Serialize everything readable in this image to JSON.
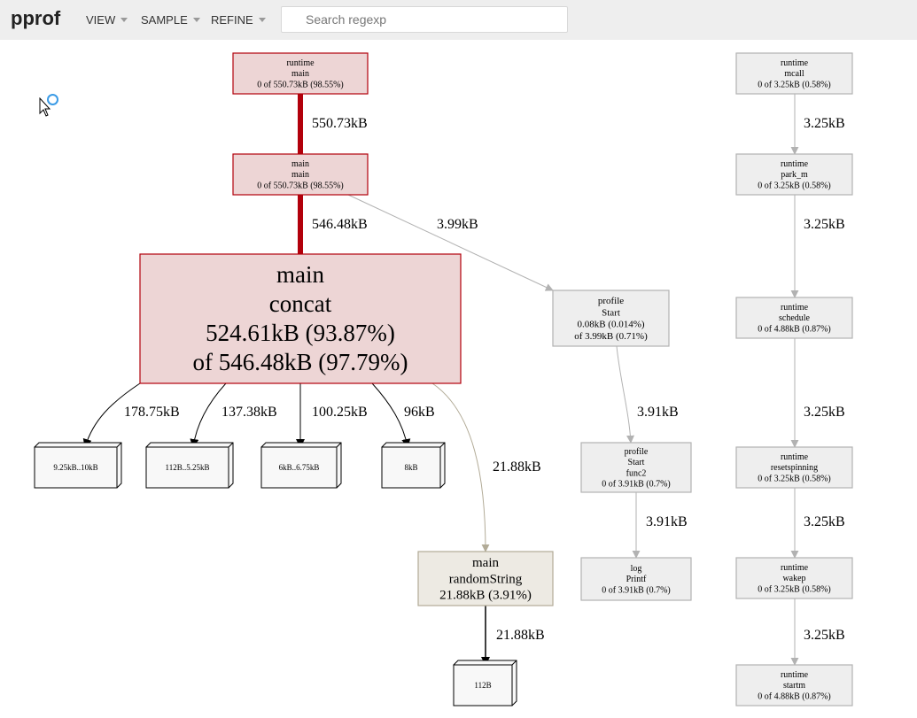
{
  "header": {
    "brand": "pprof",
    "menu": [
      "VIEW",
      "SAMPLE",
      "REFINE"
    ],
    "search_placeholder": "Search regexp"
  },
  "colors": {
    "hot_fill": "#edd5d5",
    "hot_stroke": "#b2000b",
    "warm_fill": "#edeae3",
    "warm_stroke": "#b2ab97",
    "cold_fill": "#eeeeee",
    "cold_stroke": "#b2b2b2",
    "hot_edge": "#b2000b",
    "grey_edge": "#b2b2b2"
  },
  "nodes": [
    {
      "id": "runtime_main",
      "lines": [
        "runtime",
        "main",
        "0 of 550.73kB (98.55%)"
      ],
      "style": "hot"
    },
    {
      "id": "main_main",
      "lines": [
        "main",
        "main",
        "0 of 550.73kB (98.55%)"
      ],
      "style": "hot"
    },
    {
      "id": "main_concat",
      "lines": [
        "main",
        "concat",
        "524.61kB (93.87%)",
        "of 546.48kB (97.79%)"
      ],
      "style": "hot"
    },
    {
      "id": "profile_start",
      "lines": [
        "profile",
        "Start",
        "0.08kB (0.014%)",
        "of 3.99kB (0.71%)"
      ],
      "style": "cold"
    },
    {
      "id": "profile_start_func2",
      "lines": [
        "profile",
        "Start",
        "func2",
        "0 of 3.91kB (0.7%)"
      ],
      "style": "cold"
    },
    {
      "id": "log_printf",
      "lines": [
        "log",
        "Printf",
        "0 of 3.91kB (0.7%)"
      ],
      "style": "cold"
    },
    {
      "id": "main_randomString",
      "lines": [
        "main",
        "randomString",
        "21.88kB (3.91%)"
      ],
      "style": "warm"
    },
    {
      "id": "runtime_mcall",
      "lines": [
        "runtime",
        "mcall",
        "0 of 3.25kB (0.58%)"
      ],
      "style": "cold"
    },
    {
      "id": "runtime_park_m",
      "lines": [
        "runtime",
        "park_m",
        "0 of 3.25kB (0.58%)"
      ],
      "style": "cold"
    },
    {
      "id": "runtime_schedule",
      "lines": [
        "runtime",
        "schedule",
        "0 of 4.88kB (0.87%)"
      ],
      "style": "cold"
    },
    {
      "id": "runtime_resetspinning",
      "lines": [
        "runtime",
        "resetspinning",
        "0 of 3.25kB (0.58%)"
      ],
      "style": "cold"
    },
    {
      "id": "runtime_wakep",
      "lines": [
        "runtime",
        "wakep",
        "0 of 3.25kB (0.58%)"
      ],
      "style": "cold"
    },
    {
      "id": "runtime_startm",
      "lines": [
        "runtime",
        "startm",
        "0 of 4.88kB (0.87%)"
      ],
      "style": "cold"
    }
  ],
  "size_boxes": [
    {
      "id": "b1",
      "label": "9.25kB..10kB"
    },
    {
      "id": "b2",
      "label": "112B..5.25kB"
    },
    {
      "id": "b3",
      "label": "6kB..6.75kB"
    },
    {
      "id": "b4",
      "label": "8kB"
    },
    {
      "id": "b5",
      "label": "112B"
    }
  ],
  "edges": [
    {
      "from": "runtime_main",
      "to": "main_main",
      "label": "550.73kB",
      "style": "hot"
    },
    {
      "from": "main_main",
      "to": "main_concat",
      "label": "546.48kB",
      "style": "hot"
    },
    {
      "from": "main_main",
      "to": "profile_start",
      "label": "3.99kB",
      "style": "grey"
    },
    {
      "from": "main_concat",
      "to": "b1",
      "label": "178.75kB",
      "style": "black"
    },
    {
      "from": "main_concat",
      "to": "b2",
      "label": "137.38kB",
      "style": "black"
    },
    {
      "from": "main_concat",
      "to": "b3",
      "label": "100.25kB",
      "style": "black"
    },
    {
      "from": "main_concat",
      "to": "b4",
      "label": "96kB",
      "style": "black"
    },
    {
      "from": "main_concat",
      "to": "main_randomString",
      "label": "21.88kB",
      "style": "warm"
    },
    {
      "from": "main_randomString",
      "to": "b5",
      "label": "21.88kB",
      "style": "black"
    },
    {
      "from": "profile_start",
      "to": "profile_start_func2",
      "label": "3.91kB",
      "style": "grey"
    },
    {
      "from": "profile_start_func2",
      "to": "log_printf",
      "label": "3.91kB",
      "style": "grey"
    },
    {
      "from": "runtime_mcall",
      "to": "runtime_park_m",
      "label": "3.25kB",
      "style": "grey"
    },
    {
      "from": "runtime_park_m",
      "to": "runtime_schedule",
      "label": "3.25kB",
      "style": "grey"
    },
    {
      "from": "runtime_schedule",
      "to": "runtime_resetspinning",
      "label": "3.25kB",
      "style": "grey"
    },
    {
      "from": "runtime_resetspinning",
      "to": "runtime_wakep",
      "label": "3.25kB",
      "style": "grey"
    },
    {
      "from": "runtime_wakep",
      "to": "runtime_startm",
      "label": "3.25kB",
      "style": "grey"
    }
  ]
}
